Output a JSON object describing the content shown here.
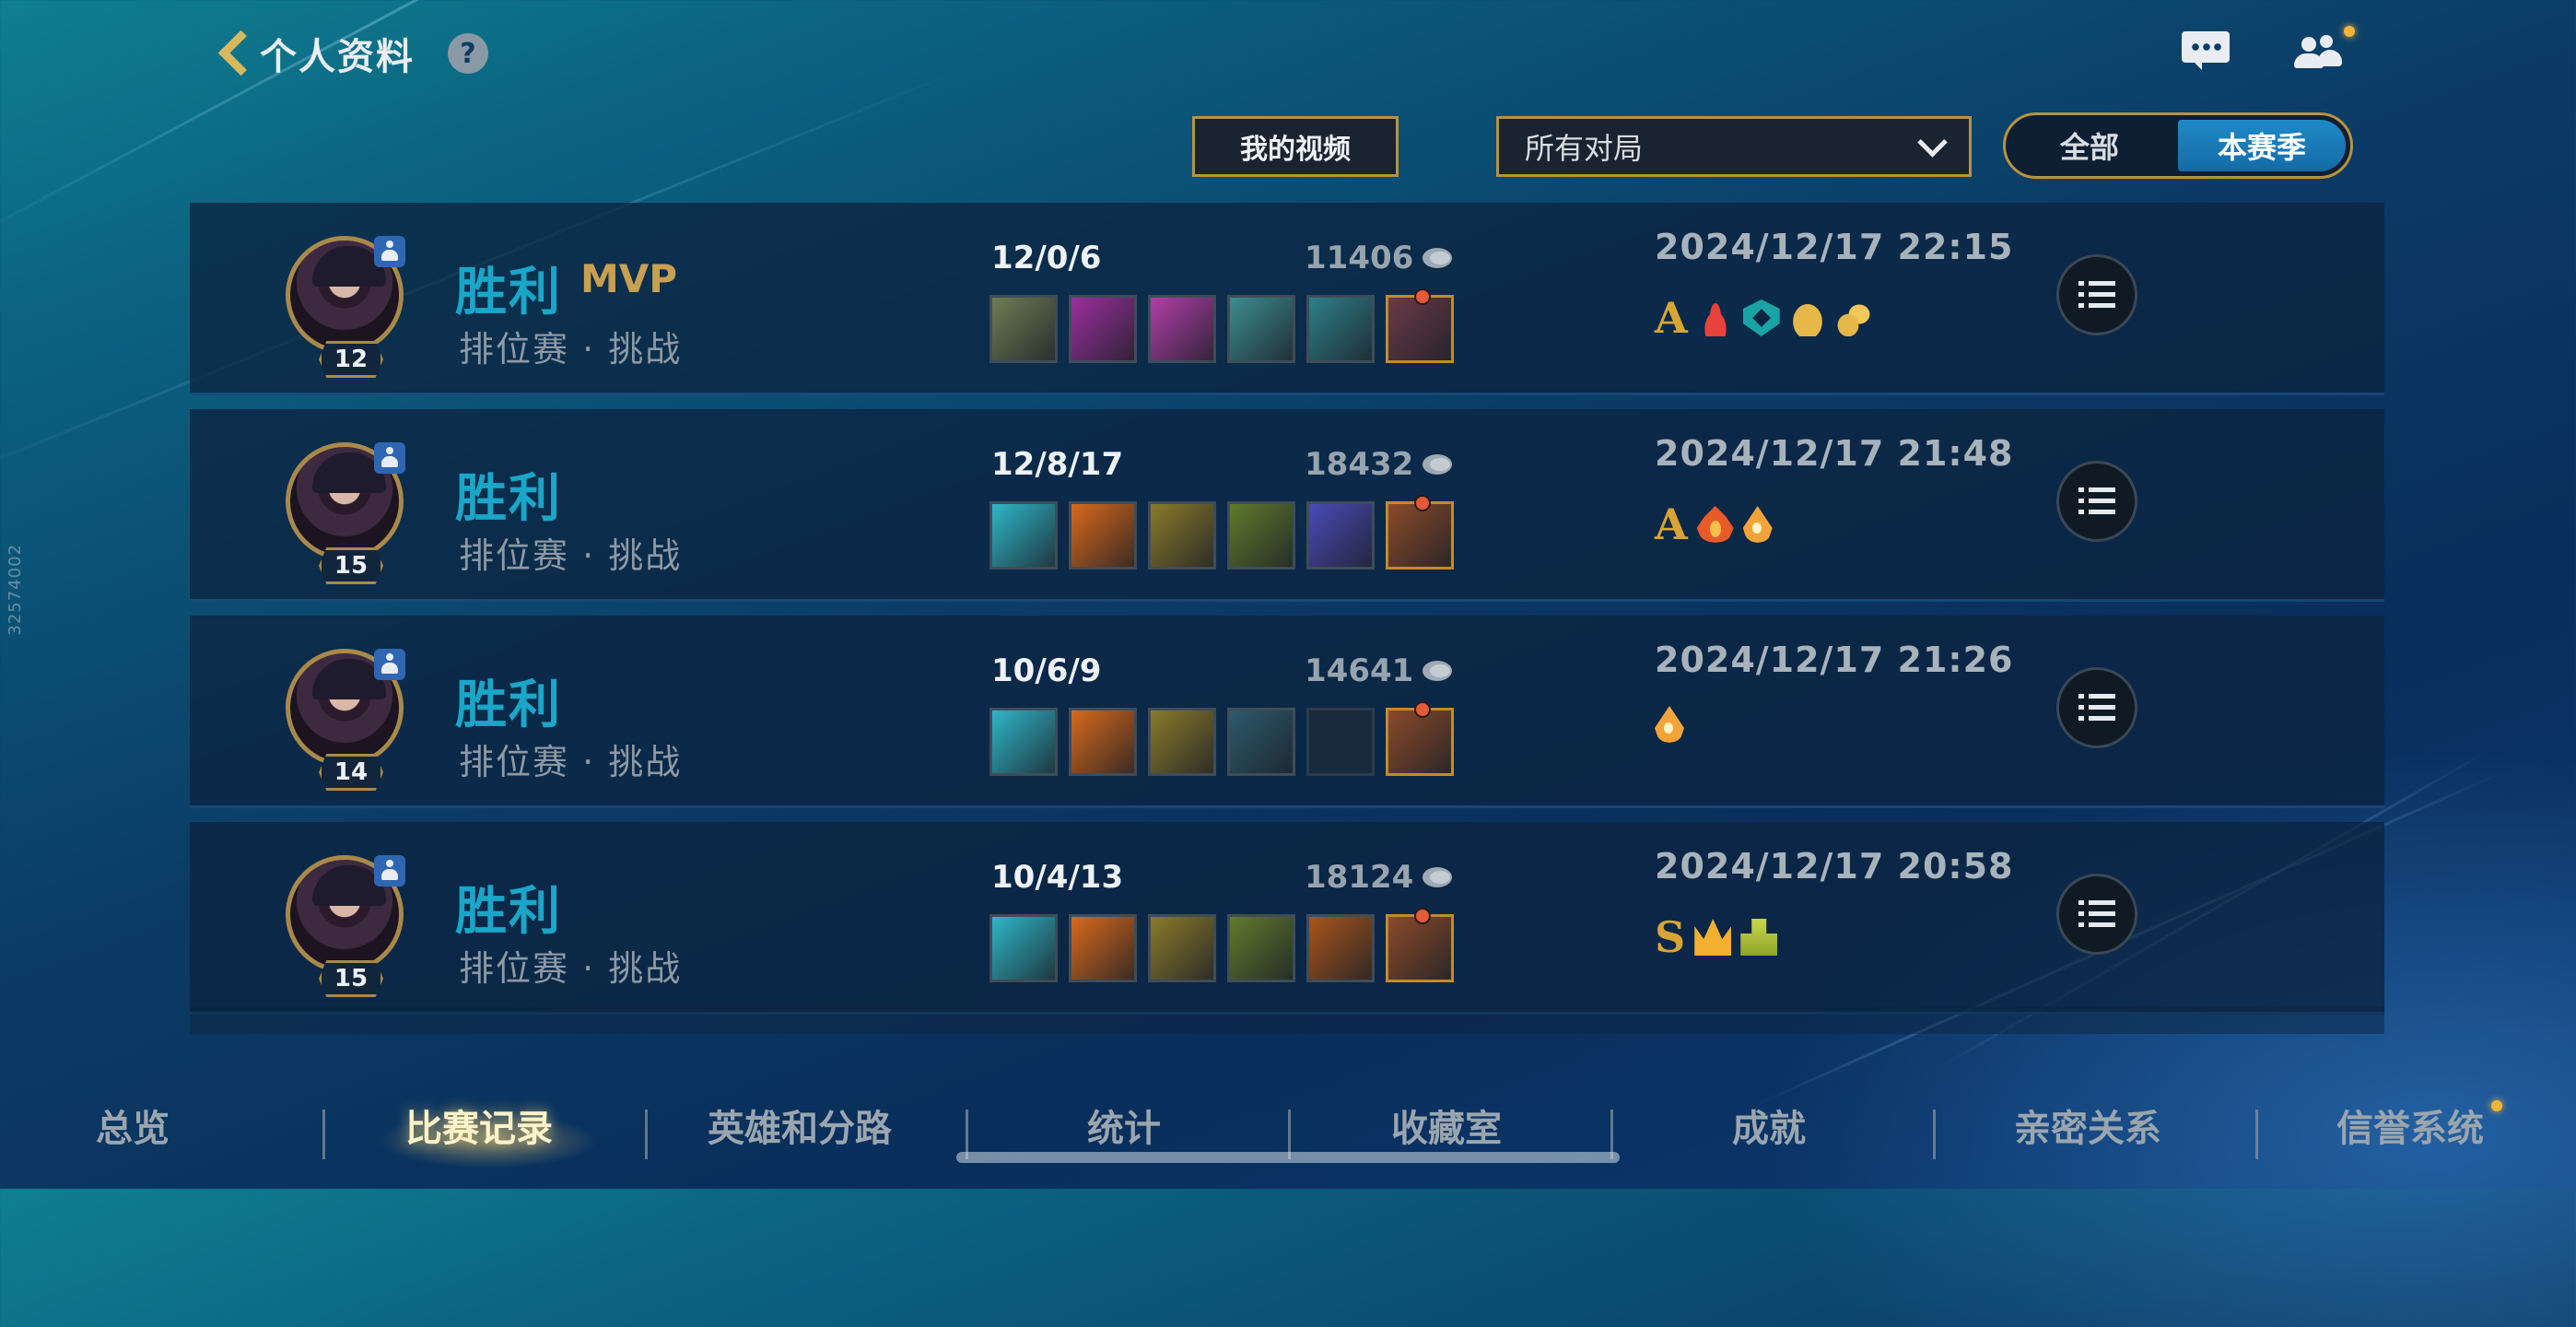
{
  "header": {
    "title": "个人资料",
    "help_glyph": "?"
  },
  "toolbar": {
    "my_videos_label": "我的视频",
    "match_filter_value": "所有对局",
    "season_options": [
      "全部",
      "本赛季"
    ],
    "season_active": "本赛季"
  },
  "matches": [
    {
      "result": "胜利",
      "mvp": "MVP",
      "mode": "排位赛 · 挑战",
      "level": "12",
      "kda": "12/0/6",
      "gold": "11406",
      "datetime": "2024/12/17 22:15",
      "grade": "A",
      "badges": [
        "lotus-icon",
        "shield-icon",
        "coin-icon",
        "coins-icon"
      ],
      "items": [
        "#6e7d54",
        "#9b2f9c",
        "#b13ea8",
        "#3c8c90",
        "#2e7f8a",
        "#6a3a48"
      ]
    },
    {
      "result": "胜利",
      "mvp": "",
      "mode": "排位赛 · 挑战",
      "level": "15",
      "kda": "12/8/17",
      "gold": "18432",
      "datetime": "2024/12/17 21:48",
      "grade": "A",
      "badges": [
        "fire-icon",
        "drop-icon"
      ],
      "items": [
        "#2fb6c8",
        "#d8691c",
        "#8a7a2a",
        "#5f7a2c",
        "#4a4ab8",
        "#8a4a2a"
      ]
    },
    {
      "result": "胜利",
      "mvp": "",
      "mode": "排位赛 · 挑战",
      "level": "14",
      "kda": "10/6/9",
      "gold": "14641",
      "datetime": "2024/12/17 21:26",
      "grade": "",
      "badges": [
        "drop-icon"
      ],
      "items": [
        "#2fb6c8",
        "#d8691c",
        "#8a7a2a",
        "#2c5a6c",
        "",
        "#8a4a2a"
      ]
    },
    {
      "result": "胜利",
      "mvp": "",
      "mode": "排位赛 · 挑战",
      "level": "15",
      "kda": "10/4/13",
      "gold": "18124",
      "datetime": "2024/12/17 20:58",
      "grade": "S",
      "badges": [
        "crown-icon",
        "podium-icon"
      ],
      "items": [
        "#2fb6c8",
        "#d8691c",
        "#8a7a2a",
        "#5f7a2c",
        "#a8541c",
        "#8a4a2a"
      ]
    }
  ],
  "bottom_nav": {
    "items": [
      "总览",
      "比赛记录",
      "英雄和分路",
      "统计",
      "收藏室",
      "成就",
      "亲密关系",
      "信誉系统"
    ],
    "active": "比赛记录"
  },
  "side_id": "32574002",
  "colors": {
    "accent_gold": "#b7933f",
    "victory": "#1aa6c8",
    "mvp": "#c8a052"
  }
}
